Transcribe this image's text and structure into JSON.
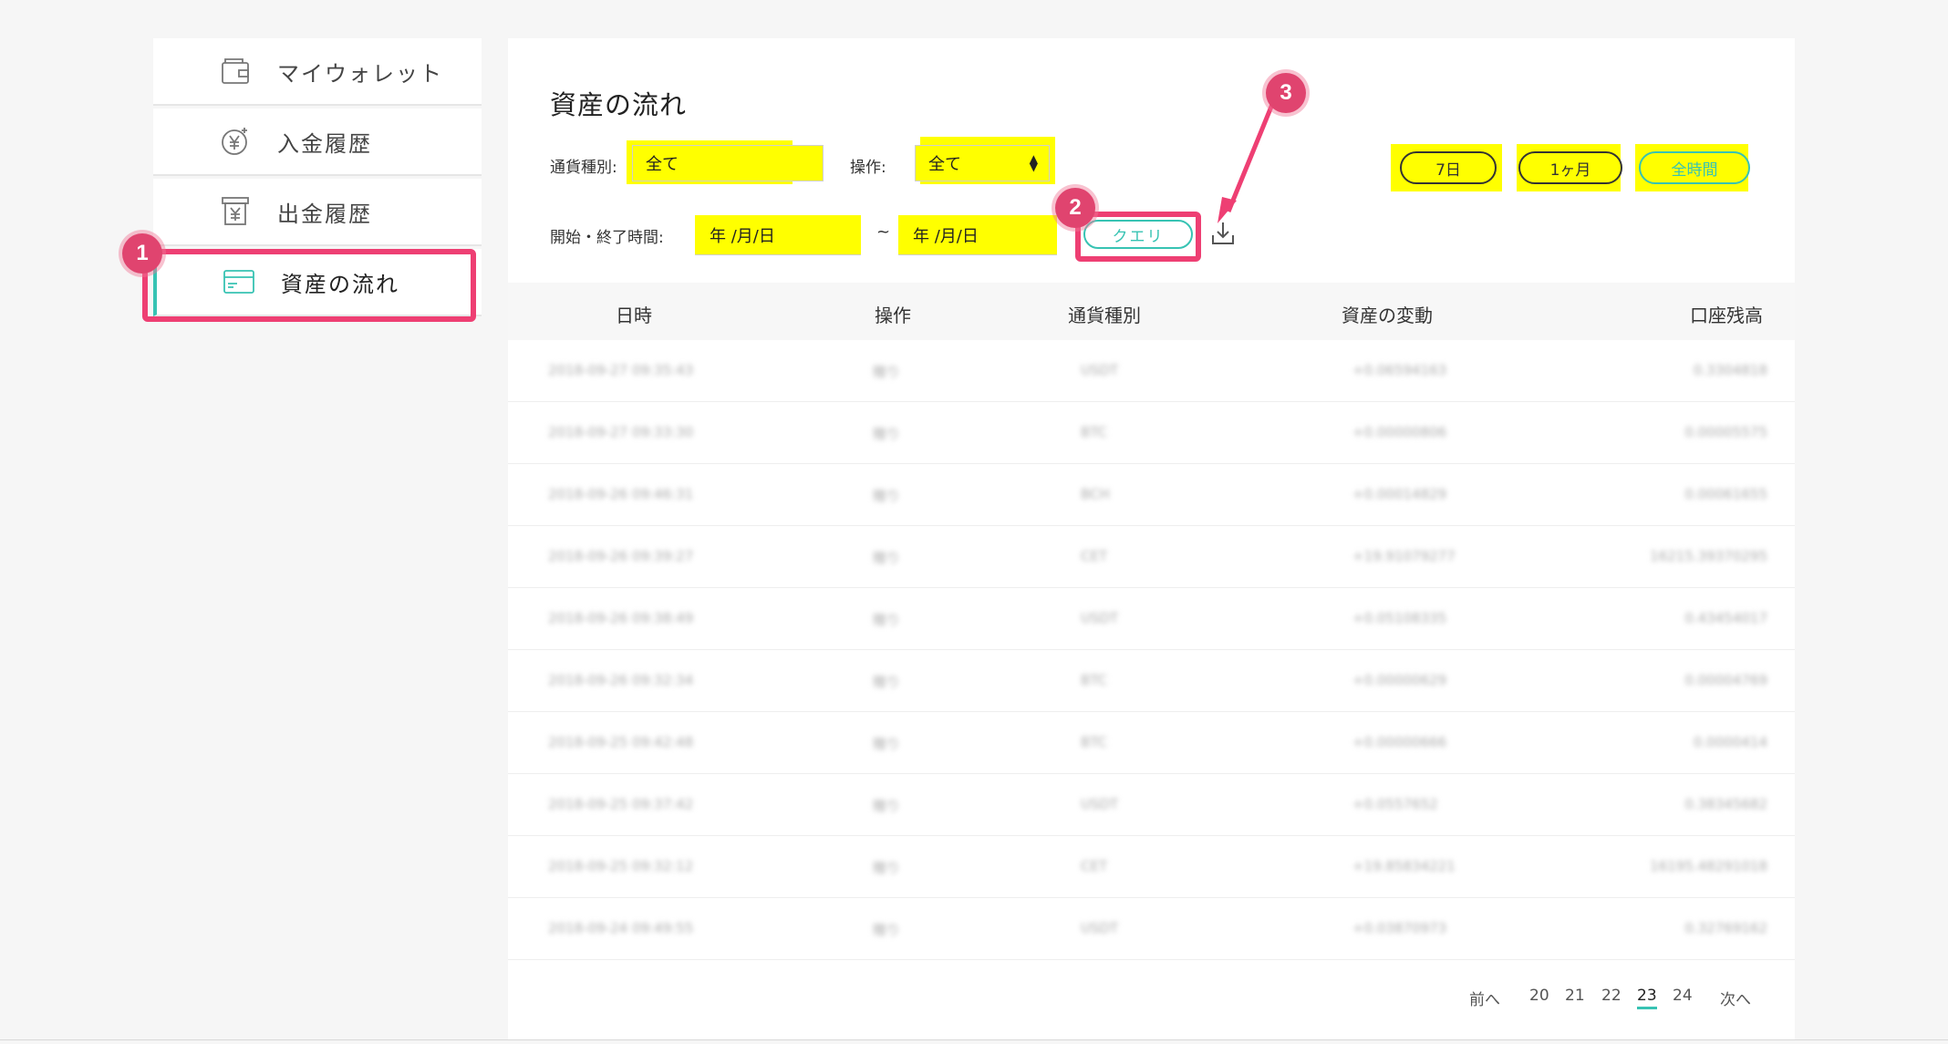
{
  "sidebar": {
    "items": [
      {
        "label": "マイウォレット",
        "icon": "wallet-icon"
      },
      {
        "label": "入金履歴",
        "icon": "deposit-yen-icon"
      },
      {
        "label": "出金履歴",
        "icon": "withdraw-yen-icon"
      },
      {
        "label": "資産の流れ",
        "icon": "card-icon",
        "active": true
      }
    ]
  },
  "main": {
    "title": "資産の流れ",
    "filters": {
      "currency_label": "通貨種別:",
      "currency_value": "全て",
      "operation_label": "操作:",
      "operation_value": "全て",
      "time_label": "開始・終了時間:",
      "start_placeholder": "年 /月/日",
      "end_placeholder": "年 /月/日",
      "tilde": "~",
      "query_label": "クエリ"
    },
    "ranges": [
      "7日",
      "1ヶ月",
      "全時間"
    ],
    "table": {
      "headers": [
        "日時",
        "操作",
        "通貨種別",
        "資産の変動",
        "口座残高"
      ],
      "rows": [
        [
          "2018-09-27 09:35:43",
          "贈り",
          "USDT",
          "+0.06594163",
          "0.3304818"
        ],
        [
          "2018-09-27 09:33:30",
          "贈り",
          "BTC",
          "+0.00000806",
          "0.00005575"
        ],
        [
          "2018-09-26 09:46:31",
          "贈り",
          "BCH",
          "+0.00014829",
          "0.00061655"
        ],
        [
          "2018-09-26 09:39:27",
          "贈り",
          "CET",
          "+19.91079277",
          "16215.39370295"
        ],
        [
          "2018-09-26 09:38:49",
          "贈り",
          "USDT",
          "+0.05108335",
          "0.43454017"
        ],
        [
          "2018-09-26 09:32:34",
          "贈り",
          "BTC",
          "+0.00000629",
          "0.00004769"
        ],
        [
          "2018-09-25 09:42:48",
          "贈り",
          "BTC",
          "+0.00000666",
          "0.0000414"
        ],
        [
          "2018-09-25 09:37:42",
          "贈り",
          "USDT",
          "+0.0557652",
          "0.38345682"
        ],
        [
          "2018-09-25 09:32:12",
          "贈り",
          "CET",
          "+19.85834221",
          "16195.48291018"
        ],
        [
          "2018-09-24 09:49:55",
          "贈り",
          "USDT",
          "+0.03870973",
          "0.32769162"
        ]
      ]
    },
    "pagination": {
      "prev": "前へ",
      "pages": [
        "20",
        "21",
        "22",
        "23",
        "24"
      ],
      "current": "23",
      "next": "次へ"
    }
  },
  "annotations": [
    "1",
    "2",
    "3"
  ],
  "colors": {
    "accent": "#37c3b3",
    "callout": "#ee3f73",
    "highlight": "#ffff00"
  }
}
